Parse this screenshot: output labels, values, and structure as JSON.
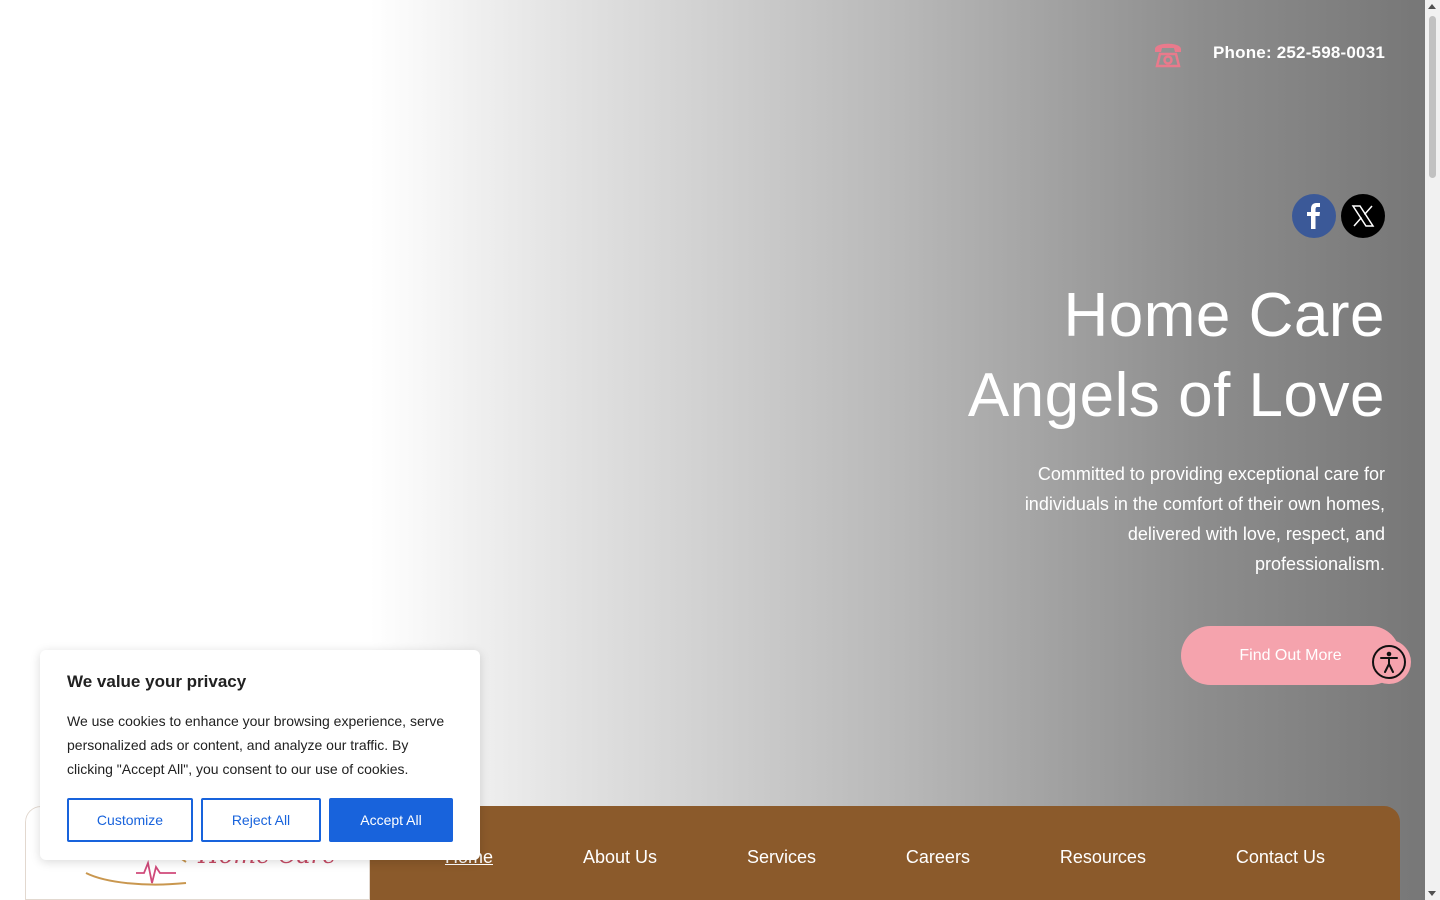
{
  "header": {
    "phone_label": "Phone: 252-598-0031"
  },
  "social": {
    "facebook_icon": "facebook-icon",
    "x_icon": "x-twitter-icon"
  },
  "hero": {
    "title_line1": "Home Care",
    "title_line2": "Angels of Love",
    "description": "Committed to providing exceptional care for individuals in the comfort of their own homes, delivered with love, respect, and professionalism.",
    "cta_label": "Find Out More"
  },
  "logo": {
    "script_text": "Home Care"
  },
  "nav": {
    "items": [
      {
        "label": "Home",
        "active": true
      },
      {
        "label": "About Us"
      },
      {
        "label": "Services"
      },
      {
        "label": "Careers"
      },
      {
        "label": "Resources"
      },
      {
        "label": "Contact Us"
      }
    ]
  },
  "cookie": {
    "title": "We value your privacy",
    "text": "We use cookies to enhance your browsing experience, serve personalized ads or content, and analyze our traffic. By clicking \"Accept All\", you consent to our use of cookies.",
    "customize_label": "Customize",
    "reject_label": "Reject All",
    "accept_label": "Accept All"
  },
  "colors": {
    "nav_bg": "#8b5a2b",
    "cta_bg": "#f5a3ad",
    "cookie_accent": "#1863dc",
    "facebook": "#3b5998"
  }
}
